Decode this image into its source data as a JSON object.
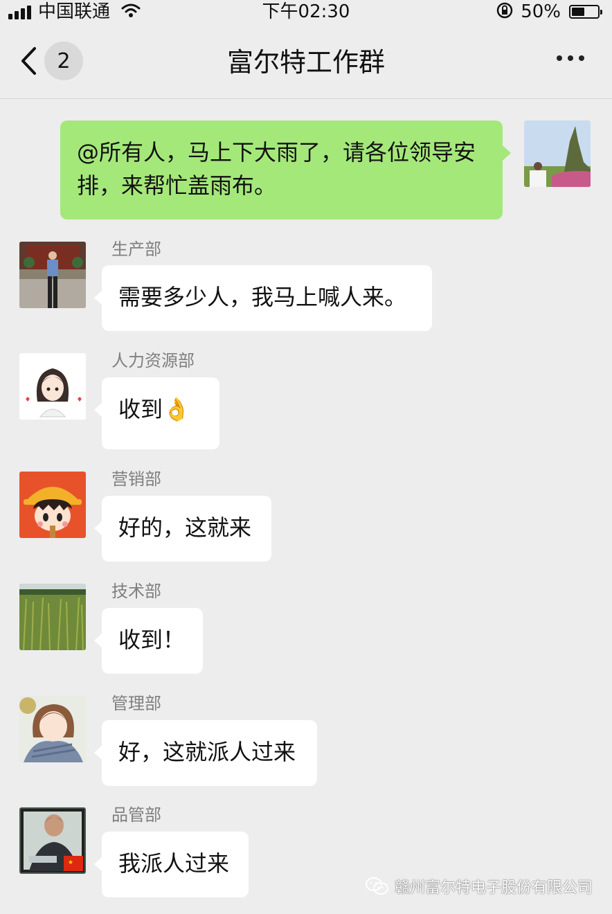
{
  "status_bar": {
    "carrier": "中国联通",
    "time": "下午02:30",
    "battery_percent_text": "50%",
    "battery_level": 0.5
  },
  "nav": {
    "back_badge": "2",
    "title": "富尔特工作群",
    "icons": {
      "back": "chevron-left-icon",
      "more": "more-dots-icon"
    }
  },
  "messages": [
    {
      "side": "right",
      "sender": "",
      "text": "@所有人，马上下大雨了，请各位领导安排，来帮忙盖雨布。"
    },
    {
      "side": "left",
      "sender": "生产部",
      "text": "需要多少人，我马上喊人来。"
    },
    {
      "side": "left",
      "sender": "人力资源部",
      "text": "收到👌"
    },
    {
      "side": "left",
      "sender": "营销部",
      "text": "好的，这就来"
    },
    {
      "side": "left",
      "sender": "技术部",
      "text": "收到！"
    },
    {
      "side": "left",
      "sender": "管理部",
      "text": "好，这就派人过来"
    },
    {
      "side": "left",
      "sender": "品管部",
      "text": "我派人过来"
    }
  ],
  "watermark": {
    "text": "赣州富尔特电子股份有限公司",
    "icon": "wechat-icon"
  },
  "colors": {
    "background": "#ededed",
    "own_bubble": "#a5e87a",
    "other_bubble": "#ffffff"
  }
}
